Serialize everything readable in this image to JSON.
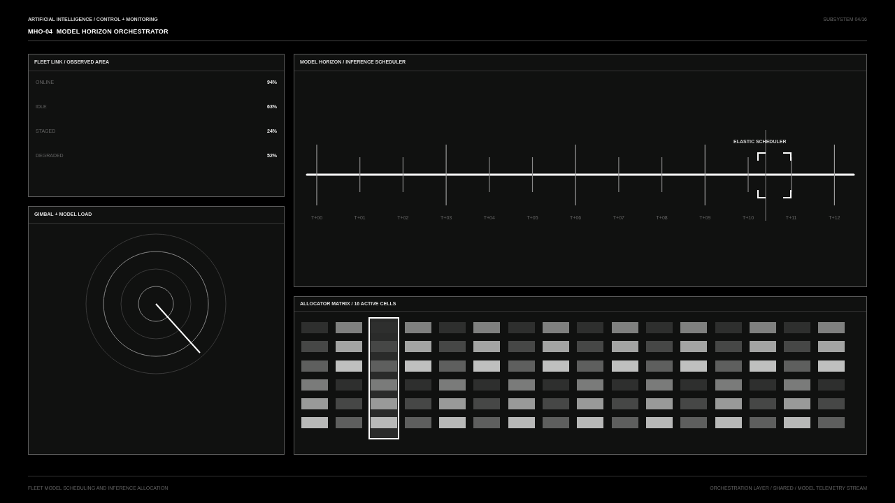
{
  "header": {
    "breadcrumb": "ARTIFICIAL INTELLIGENCE / CONTROL + MONITORING",
    "title": "MHO-04  MODEL HORIZON ORCHESTRATOR",
    "subsystem": "SUBSYSTEM 04/16"
  },
  "fleet_panel": {
    "title": "FLEET LINK / OBSERVED AREA",
    "rows": [
      {
        "label": "ONLINE",
        "value": "94%"
      },
      {
        "label": "IDLE",
        "value": "63%"
      },
      {
        "label": "STAGED",
        "value": "24%"
      },
      {
        "label": "DEGRADED",
        "value": "52%"
      }
    ]
  },
  "gimbal_panel": {
    "title": "GIMBAL + MODEL LOAD"
  },
  "scheduler_panel": {
    "title": "MODEL HORIZON / INFERENCE SCHEDULER",
    "cursor_label": "ELASTIC SCHEDULER",
    "ticks": [
      {
        "kind": "major",
        "label": "T+00"
      },
      {
        "kind": "minor",
        "label": "T+01"
      },
      {
        "kind": "minor",
        "label": "T+02"
      },
      {
        "kind": "major",
        "label": "T+03"
      },
      {
        "kind": "minor",
        "label": "T+04"
      },
      {
        "kind": "minor",
        "label": "T+05"
      },
      {
        "kind": "major",
        "label": "T+06"
      },
      {
        "kind": "minor",
        "label": "T+07"
      },
      {
        "kind": "minor",
        "label": "T+08"
      },
      {
        "kind": "major",
        "label": "T+09"
      },
      {
        "kind": "minor",
        "label": "T+10"
      },
      {
        "kind": "minor",
        "label": "T+11"
      },
      {
        "kind": "major",
        "label": "T+12"
      }
    ]
  },
  "matrix_panel": {
    "title": "ALLOCATOR MATRIX / 16 ACTIVE CELLS",
    "columns": [
      {
        "selected": false,
        "cells": [
          {
            "color": "#2e2f2e"
          },
          {
            "color": "#464746"
          },
          {
            "color": "#5e5f5e"
          },
          {
            "color": "#7a7b7a"
          },
          {
            "color": "#999a99"
          },
          {
            "color": "#b8b9b8"
          }
        ]
      },
      {
        "selected": false,
        "cells": [
          {
            "color": "#7f807f"
          },
          {
            "color": "#a3a4a3"
          },
          {
            "color": "#bfc0bf"
          },
          {
            "color": "#2e2f2e"
          },
          {
            "color": "#464746"
          },
          {
            "color": "#5e5f5e"
          }
        ]
      },
      {
        "selected": true,
        "cells": [
          {
            "color": "#2e2f2e"
          },
          {
            "color": "#464746"
          },
          {
            "color": "#5e5f5e"
          },
          {
            "color": "#7a7b7a"
          },
          {
            "color": "#999a99"
          },
          {
            "color": "#b8b9b8"
          }
        ]
      },
      {
        "selected": false,
        "cells": [
          {
            "color": "#7f807f"
          },
          {
            "color": "#a3a4a3"
          },
          {
            "color": "#bfc0bf"
          },
          {
            "color": "#2e2f2e"
          },
          {
            "color": "#464746"
          },
          {
            "color": "#5e5f5e"
          }
        ]
      },
      {
        "selected": false,
        "cells": [
          {
            "color": "#2e2f2e"
          },
          {
            "color": "#464746"
          },
          {
            "color": "#5e5f5e"
          },
          {
            "color": "#7a7b7a"
          },
          {
            "color": "#999a99"
          },
          {
            "color": "#b8b9b8"
          }
        ]
      },
      {
        "selected": false,
        "cells": [
          {
            "color": "#7f807f"
          },
          {
            "color": "#a3a4a3"
          },
          {
            "color": "#bfc0bf"
          },
          {
            "color": "#2e2f2e"
          },
          {
            "color": "#464746"
          },
          {
            "color": "#5e5f5e"
          }
        ]
      },
      {
        "selected": false,
        "cells": [
          {
            "color": "#2e2f2e"
          },
          {
            "color": "#464746"
          },
          {
            "color": "#5e5f5e"
          },
          {
            "color": "#7a7b7a"
          },
          {
            "color": "#999a99"
          },
          {
            "color": "#b8b9b8"
          }
        ]
      },
      {
        "selected": false,
        "cells": [
          {
            "color": "#7f807f"
          },
          {
            "color": "#a3a4a3"
          },
          {
            "color": "#bfc0bf"
          },
          {
            "color": "#2e2f2e"
          },
          {
            "color": "#464746"
          },
          {
            "color": "#5e5f5e"
          }
        ]
      },
      {
        "selected": false,
        "cells": [
          {
            "color": "#2e2f2e"
          },
          {
            "color": "#464746"
          },
          {
            "color": "#5e5f5e"
          },
          {
            "color": "#7a7b7a"
          },
          {
            "color": "#999a99"
          },
          {
            "color": "#b8b9b8"
          }
        ]
      },
      {
        "selected": false,
        "cells": [
          {
            "color": "#7f807f"
          },
          {
            "color": "#a3a4a3"
          },
          {
            "color": "#bfc0bf"
          },
          {
            "color": "#2e2f2e"
          },
          {
            "color": "#464746"
          },
          {
            "color": "#5e5f5e"
          }
        ]
      },
      {
        "selected": false,
        "cells": [
          {
            "color": "#2e2f2e"
          },
          {
            "color": "#464746"
          },
          {
            "color": "#5e5f5e"
          },
          {
            "color": "#7a7b7a"
          },
          {
            "color": "#999a99"
          },
          {
            "color": "#b8b9b8"
          }
        ]
      },
      {
        "selected": false,
        "cells": [
          {
            "color": "#7f807f"
          },
          {
            "color": "#a3a4a3"
          },
          {
            "color": "#bfc0bf"
          },
          {
            "color": "#2e2f2e"
          },
          {
            "color": "#464746"
          },
          {
            "color": "#5e5f5e"
          }
        ]
      },
      {
        "selected": false,
        "cells": [
          {
            "color": "#2e2f2e"
          },
          {
            "color": "#464746"
          },
          {
            "color": "#5e5f5e"
          },
          {
            "color": "#7a7b7a"
          },
          {
            "color": "#999a99"
          },
          {
            "color": "#b8b9b8"
          }
        ]
      },
      {
        "selected": false,
        "cells": [
          {
            "color": "#7f807f"
          },
          {
            "color": "#a3a4a3"
          },
          {
            "color": "#bfc0bf"
          },
          {
            "color": "#2e2f2e"
          },
          {
            "color": "#464746"
          },
          {
            "color": "#5e5f5e"
          }
        ]
      },
      {
        "selected": false,
        "cells": [
          {
            "color": "#2e2f2e"
          },
          {
            "color": "#464746"
          },
          {
            "color": "#5e5f5e"
          },
          {
            "color": "#7a7b7a"
          },
          {
            "color": "#999a99"
          },
          {
            "color": "#b8b9b8"
          }
        ]
      },
      {
        "selected": false,
        "cells": [
          {
            "color": "#7f807f"
          },
          {
            "color": "#a3a4a3"
          },
          {
            "color": "#bfc0bf"
          },
          {
            "color": "#2e2f2e"
          },
          {
            "color": "#464746"
          },
          {
            "color": "#5e5f5e"
          }
        ]
      }
    ]
  },
  "footer": {
    "left": "FLEET MODEL SCHEDULING AND INFERENCE ALLOCATION",
    "right": "ORCHESTRATION LAYER / SHARED / MODEL TELEMETRY STREAM"
  }
}
